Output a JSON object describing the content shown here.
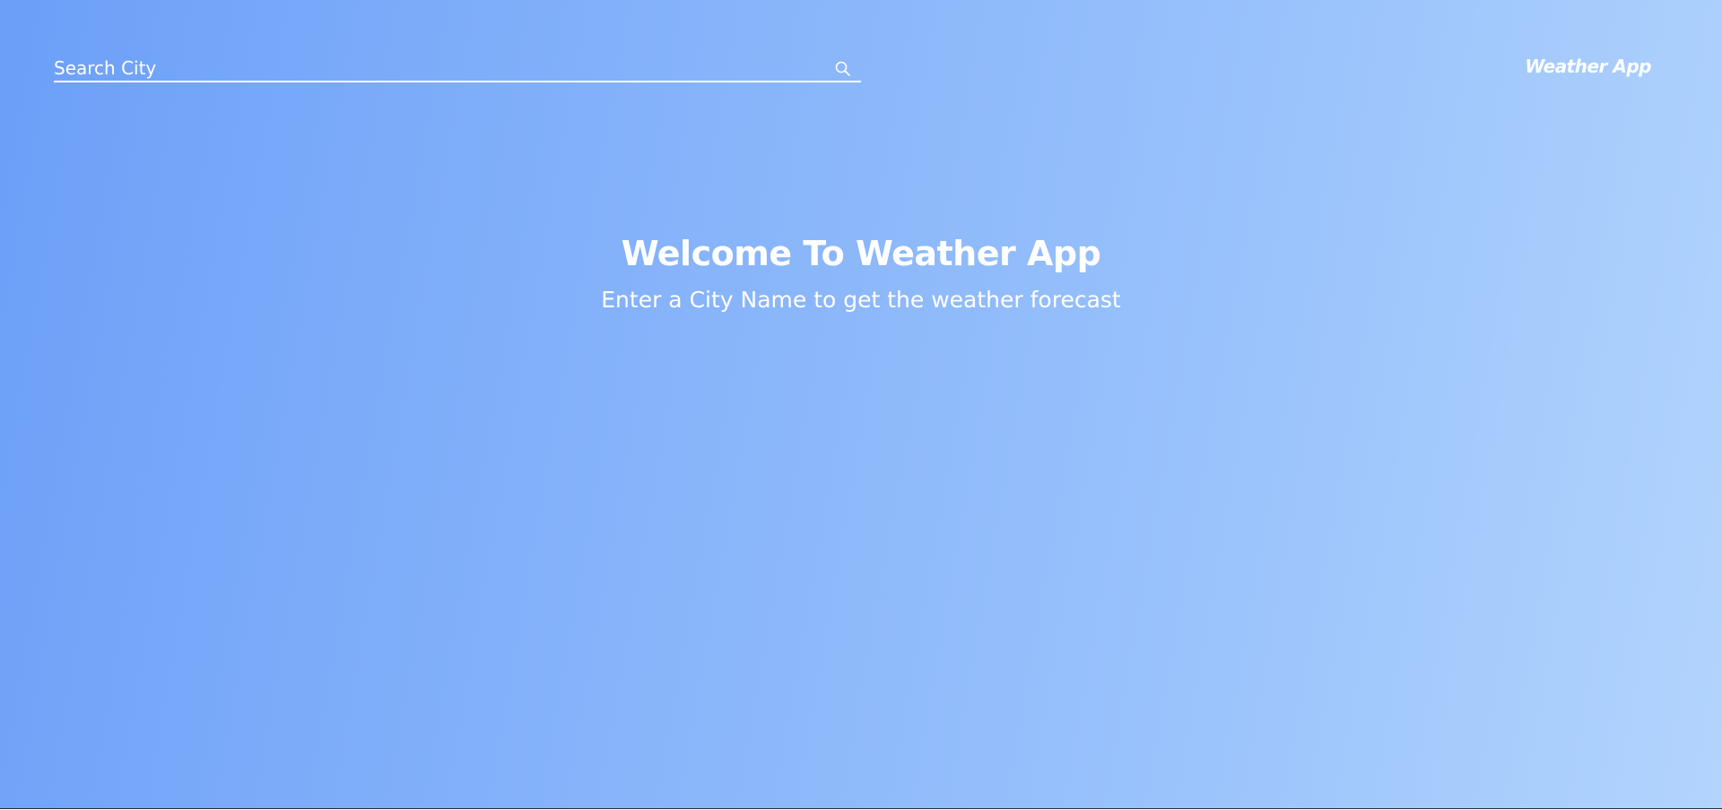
{
  "search": {
    "placeholder": "Search City",
    "value": "",
    "icon": "search-icon"
  },
  "header": {
    "brand": "Weather App"
  },
  "main": {
    "title": "Welcome To Weather App",
    "subtitle": "Enter a City Name to get the weather forecast"
  },
  "colors": {
    "gradient_start": "#6b9ff8",
    "gradient_end": "#b2d4fd",
    "text": "#ffffff"
  }
}
